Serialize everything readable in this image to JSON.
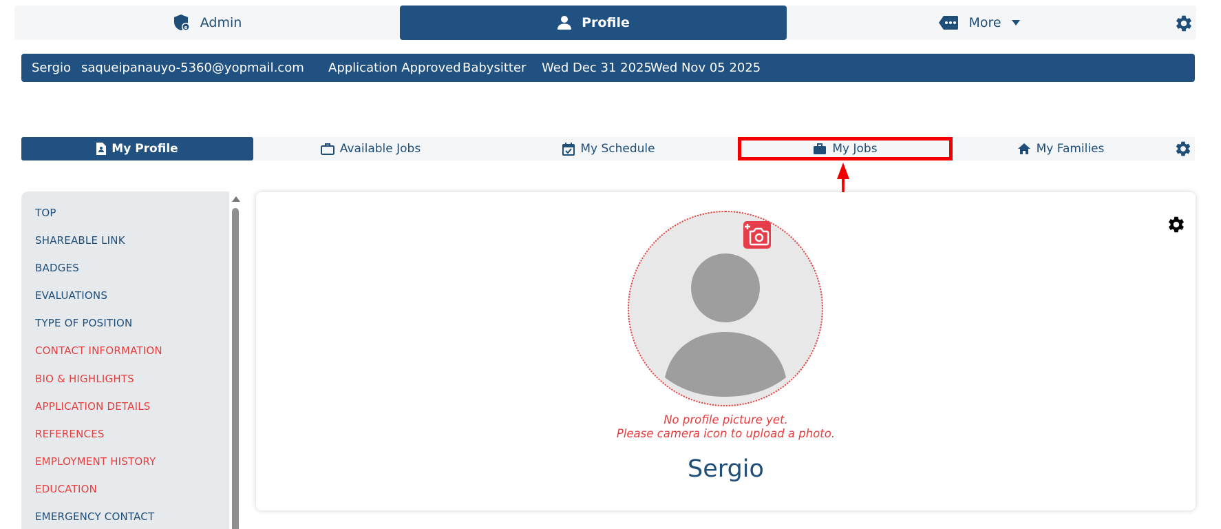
{
  "topnav": {
    "admin_label": "Admin",
    "profile_label": "Profile",
    "more_label": "More"
  },
  "infobar": {
    "name": "Sergio",
    "email": "saqueipanauyo-5360@yopmail.com",
    "status": "Application Approved",
    "role": "Babysitter",
    "date1": "Wed Dec 31 2025",
    "date2": "Wed Nov 05 2025"
  },
  "tabs": [
    {
      "label": "My Profile",
      "icon": "document-icon"
    },
    {
      "label": "Available Jobs",
      "icon": "briefcase-outline-icon"
    },
    {
      "label": "My Schedule",
      "icon": "calendar-check-icon"
    },
    {
      "label": "My Jobs",
      "icon": "briefcase-icon"
    },
    {
      "label": "My Families",
      "icon": "home-icon"
    }
  ],
  "sidebar": {
    "items": [
      {
        "label": "TOP",
        "state": "done"
      },
      {
        "label": "SHAREABLE LINK",
        "state": "done"
      },
      {
        "label": "BADGES",
        "state": "done"
      },
      {
        "label": "EVALUATIONS",
        "state": "done"
      },
      {
        "label": "TYPE OF POSITION",
        "state": "done"
      },
      {
        "label": "CONTACT INFORMATION",
        "state": "todo"
      },
      {
        "label": "BIO & HIGHLIGHTS",
        "state": "todo"
      },
      {
        "label": "APPLICATION DETAILS",
        "state": "todo"
      },
      {
        "label": "REFERENCES",
        "state": "todo"
      },
      {
        "label": "EMPLOYMENT HISTORY",
        "state": "todo"
      },
      {
        "label": "EDUCATION",
        "state": "todo"
      },
      {
        "label": "EMERGENCY CONTACT",
        "state": "done"
      }
    ]
  },
  "profile": {
    "no_picture_line1": "No profile picture yet.",
    "no_picture_line2": "Please camera icon to upload a photo.",
    "name": "Sergio"
  },
  "colors": {
    "primary": "#205180",
    "accent_red": "#e53e3e",
    "highlight_border": "#f00000",
    "nav_bg": "#f4f6f8",
    "sidebar_bg": "#e6eaed"
  }
}
